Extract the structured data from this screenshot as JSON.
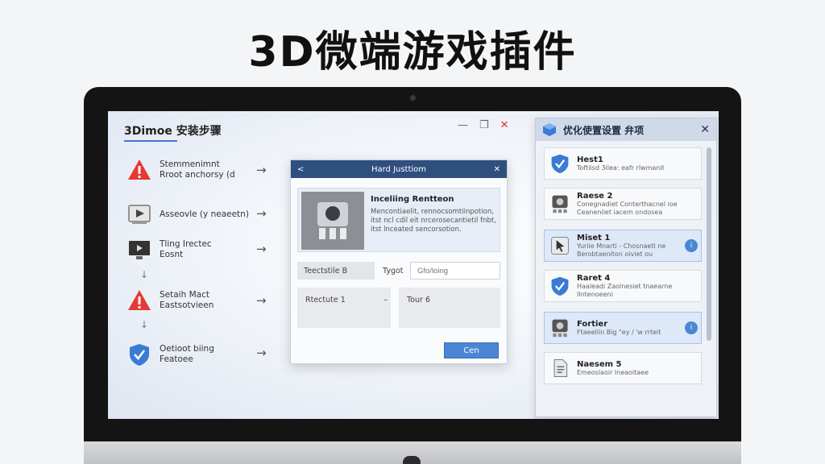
{
  "headline": "3D微端游戏插件",
  "install_window": {
    "title": "3Dimoe 安装步骤",
    "controls": {
      "minimize": "—",
      "maximize": "❐",
      "close": "✕"
    },
    "steps": [
      {
        "line1": "Stemmenimnt",
        "line2": "Rroot anchorsy (d",
        "icon": "warning-icon"
      },
      {
        "line1": "Asseovle (y neaeetn)",
        "line2": "",
        "icon": "media-player-icon"
      },
      {
        "line1": "Tling Irectec",
        "line2": "Eosnt",
        "icon": "monitor-icon"
      },
      {
        "line1": "Setaih Mact",
        "line2": "Eastsotvieen",
        "icon": "warning-icon"
      },
      {
        "line1": "Oetioot biing",
        "line2": "Featoee",
        "icon": "shield-icon"
      }
    ],
    "arrow_glyph": "→",
    "down_glyph": "↓"
  },
  "dialog": {
    "title": "Hard Justtiom",
    "back_glyph": "<",
    "close_glyph": "✕",
    "card_title": "Inceliing Rentteon",
    "card_desc": "Mencontiaelit, rennocsomtiinpotion, itst ncl cdil eit nrcerosecantietil fnbt, itst lnceated sencorsotion.",
    "fields": {
      "left": "Teectstile B",
      "mid_label": "Tygot",
      "input_placeholder": "Gfo/loing",
      "box_left": "Rtectute 1",
      "box_dash": "–",
      "box_right": "Tour 6"
    },
    "button": "Cen"
  },
  "optimize_panel": {
    "title": "优化使置设置 弁项",
    "close_glyph": "✕",
    "items": [
      {
        "name": "Hest1",
        "sub1": "Toftiisd 3ilea: eafr rlwmanit",
        "sub2": "",
        "icon": "shield-icon",
        "active": false,
        "badge": ""
      },
      {
        "name": "Raese 2",
        "sub1": "Conegnadiet Conterthacnel ioe",
        "sub2": "Ceanenilet iacem ondosea",
        "icon": "hardware-icon",
        "active": false,
        "badge": ""
      },
      {
        "name": "Miset 1",
        "sub1": "Yuriie Mnarti - Chosnaetl ne",
        "sub2": "Berobtaeniton oiviet ou",
        "icon": "cursor-icon",
        "active": true,
        "badge": "i"
      },
      {
        "name": "Raret 4",
        "sub1": "Haaleadi Zaolnesiet tnaearne",
        "sub2": "Ilntenoeeni",
        "icon": "shield-icon",
        "active": false,
        "badge": ""
      },
      {
        "name": "Fortier",
        "sub1": "Ftaeeliin Big \"ey / 'w rrteit",
        "sub2": "",
        "icon": "hardware-icon",
        "active": true,
        "badge": "i"
      },
      {
        "name": "Naesem 5",
        "sub1": "Emeoslaoir lneaoitaee",
        "sub2": "",
        "icon": "document-icon",
        "active": false,
        "badge": ""
      }
    ]
  },
  "colors": {
    "accent": "#3b78d8",
    "dialog_header": "#2f4f7f",
    "warning": "#e53935",
    "shield": "#3a7bd5"
  }
}
